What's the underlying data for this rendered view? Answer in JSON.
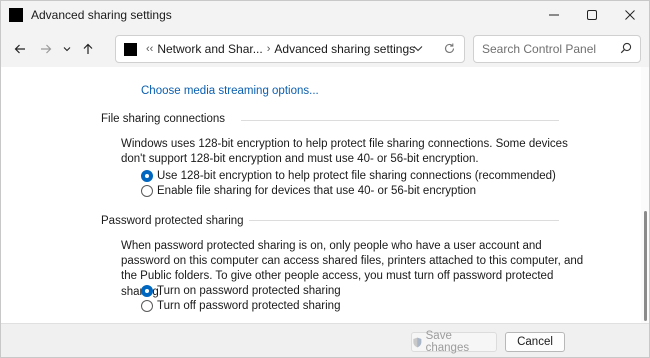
{
  "window": {
    "title": "Advanced sharing settings"
  },
  "address": {
    "breadcrumb_sep": "‹‹",
    "crumb_1": "Network and Shar...",
    "crumb_arrow": "›",
    "crumb_2": "Advanced sharing settings"
  },
  "search": {
    "placeholder": "Search Control Panel"
  },
  "media": {
    "link": "Choose media streaming options..."
  },
  "file_sharing": {
    "heading": "File sharing connections",
    "description": "Windows uses 128-bit encryption to help protect file sharing connections. Some devices don't support 128-bit encryption and must use 40- or 56-bit encryption.",
    "options": [
      {
        "label": "Use 128-bit encryption to help protect file sharing connections (recommended)",
        "checked": true
      },
      {
        "label": "Enable file sharing for devices that use 40- or 56-bit encryption",
        "checked": false
      }
    ]
  },
  "password_sharing": {
    "heading": "Password protected sharing",
    "description": "When password protected sharing is on, only people who have a user account and password on this computer can access shared files, printers attached to this computer, and the Public folders. To give other people access, you must turn off password protected sharing.",
    "options": [
      {
        "label": "Turn on password protected sharing",
        "checked": true
      },
      {
        "label": "Turn off password protected sharing",
        "checked": false
      }
    ]
  },
  "footer": {
    "save_label": "Save changes",
    "cancel_label": "Cancel"
  },
  "colors": {
    "accent": "#0067c0",
    "link": "#0b5fb0"
  }
}
